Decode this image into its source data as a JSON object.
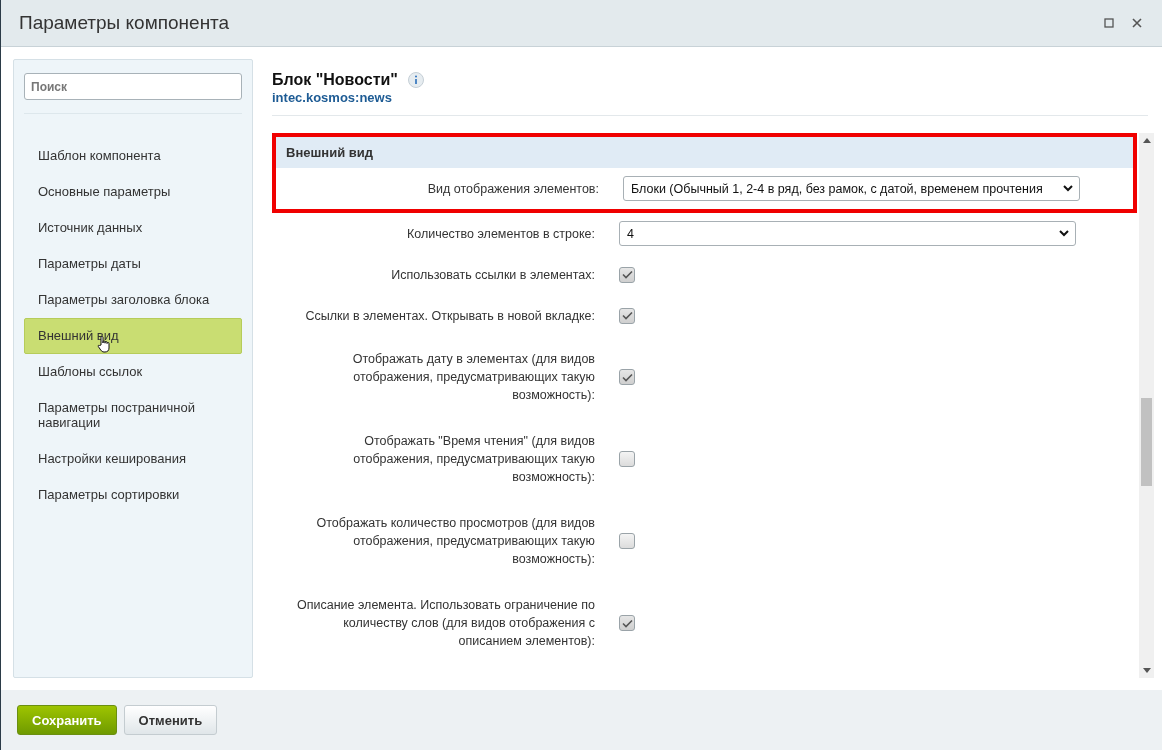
{
  "window": {
    "title": "Параметры компонента"
  },
  "sidebar": {
    "search": {
      "placeholder": "Поиск"
    },
    "items": [
      {
        "label": "Шаблон компонента",
        "selected": false
      },
      {
        "label": "Основные параметры",
        "selected": false
      },
      {
        "label": "Источник данных",
        "selected": false
      },
      {
        "label": "Параметры даты",
        "selected": false
      },
      {
        "label": "Параметры заголовка блока",
        "selected": false
      },
      {
        "label": "Внешний вид",
        "selected": true
      },
      {
        "label": "Шаблоны ссылок",
        "selected": false
      },
      {
        "label": "Параметры постраничной навигации",
        "selected": false
      },
      {
        "label": "Настройки кеширования",
        "selected": false
      },
      {
        "label": "Параметры сортировки",
        "selected": false
      }
    ]
  },
  "component": {
    "title": "Блок \"Новости\"",
    "code": "intec.kosmos:news"
  },
  "section": {
    "title": "Внешний вид",
    "fields": [
      {
        "kind": "select",
        "label": "Вид отображения элементов:",
        "value": "Блоки (Обычный 1, 2-4 в ряд, без рамок, с датой, временем прочтения",
        "highlighted": true
      },
      {
        "kind": "select",
        "label": "Количество элементов в строке:",
        "value": "4",
        "highlighted": false
      },
      {
        "kind": "checkbox",
        "label": "Использовать ссылки в элементах:",
        "checked": true,
        "highlighted": false
      },
      {
        "kind": "checkbox",
        "label": "Ссылки в элементах. Открывать в новой вкладке:",
        "checked": true,
        "highlighted": false
      },
      {
        "kind": "checkbox",
        "label": "Отображать дату в элементах (для видов отображения, предусматривающих такую возможность):",
        "checked": true,
        "highlighted": false
      },
      {
        "kind": "checkbox",
        "label": "Отображать \"Время чтения\" (для видов отображения, предусматривающих такую возможность):",
        "checked": false,
        "highlighted": false
      },
      {
        "kind": "checkbox",
        "label": "Отображать количество просмотров (для видов отображения, предусматривающих такую возможность):",
        "checked": false,
        "highlighted": false
      },
      {
        "kind": "checkbox",
        "label": "Описание элемента. Использовать ограничение по количеству слов (для видов отображения с описанием элементов):",
        "checked": true,
        "highlighted": false
      }
    ]
  },
  "buttons": [
    {
      "kind": "primary",
      "label": "Сохранить"
    },
    {
      "kind": "secondary",
      "label": "Отменить"
    }
  ]
}
